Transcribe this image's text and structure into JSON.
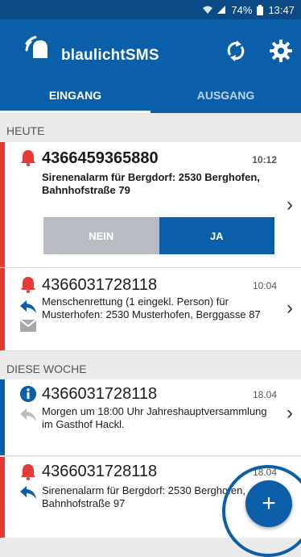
{
  "status_bar": {
    "battery": "74%",
    "time": "13:47"
  },
  "app": {
    "title": "blaulichtSMS"
  },
  "tabs": [
    {
      "label": "EINGANG"
    },
    {
      "label": "AUSGANG"
    }
  ],
  "sections": {
    "today": "HEUTE",
    "week": "DIESE WOCHE"
  },
  "messages": [
    {
      "number": "4366459365880",
      "time": "10:12",
      "text": "Sirenenalarm für Bergdorf: 2530 Berghofen, Bahnhofstraße 79"
    },
    {
      "number": "4366031728118",
      "time": "10:04",
      "text": "Menschenrettung (1 eingekl. Person) für Musterhofen: 2530 Musterhofen, Berggasse 87"
    },
    {
      "number": "4366031728118",
      "time": "18.04",
      "text": "Morgen um 18:00 Uhr Jahreshauptversammlung im Gasthof Hackl."
    },
    {
      "number": "4366031728118",
      "time": "18.04",
      "text": "Sirenenalarm für Bergdorf: 2530 Berghofen, Bahnhofstraße 97"
    }
  ],
  "response_buttons": {
    "no": "NEIN",
    "yes": "JA"
  },
  "colors": {
    "primary": "#0b5ea8",
    "alarm": "#e53935"
  }
}
